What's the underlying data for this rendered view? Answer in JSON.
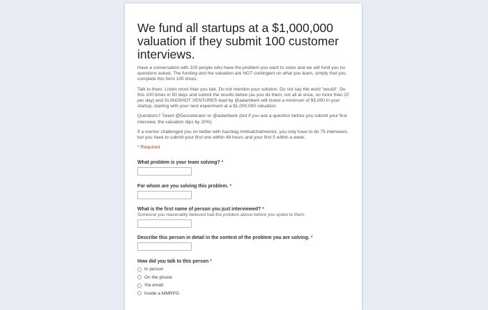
{
  "form": {
    "title": "We fund all startups at a $1,000,000 valuation if they submit 100 customer interviews.",
    "paragraphs": [
      "Have a conversation with 100 people who have the problem you want to solve and we will fund you no questions asked. The funding and the valuation are NOT contingent on what you learn, simply that you complete this form 100 times.",
      "Talk to them. Listen more than you talk. Do not mention your solution. Do not say the word \"would\". Do this 100 times in 50 days and submit the results below (as you do them, not all at once, no more than 20 per day) and SLINGSHOT VENTURES lead by @adamberk will invest a minimum of $5,000 in your startup, starting with your next experiment at a $1,000,000 valuation.",
      "Questions? Tweet @Deccelerator or @adamberk (but if you ask a question before you submit your first interview, the valuation dips by 20%)",
      "If a mentor challenged you on twitter with hashtag #milvalchalmentor, you only have to do 75 interviews, but you have to submit your first one within 48 hours and your first 5 within a week."
    ],
    "required_note": "* Required"
  },
  "questions": [
    {
      "label": "What problem is your team solving?",
      "star": "*"
    },
    {
      "label": "For whom are you solving this problem.",
      "star": "*"
    },
    {
      "label": "What is the first name of person you just interviewed?",
      "star": "*",
      "help": "Someone you reasonably believed had the problem above before you spoke to them."
    },
    {
      "label": "Describe this person in detail in the context of the problem you are solving.",
      "star": "*"
    },
    {
      "label": "How did you talk to this person",
      "star": "*",
      "options": [
        "In person",
        "On the phone",
        "Via email",
        "Inside a MMRPG"
      ]
    }
  ]
}
